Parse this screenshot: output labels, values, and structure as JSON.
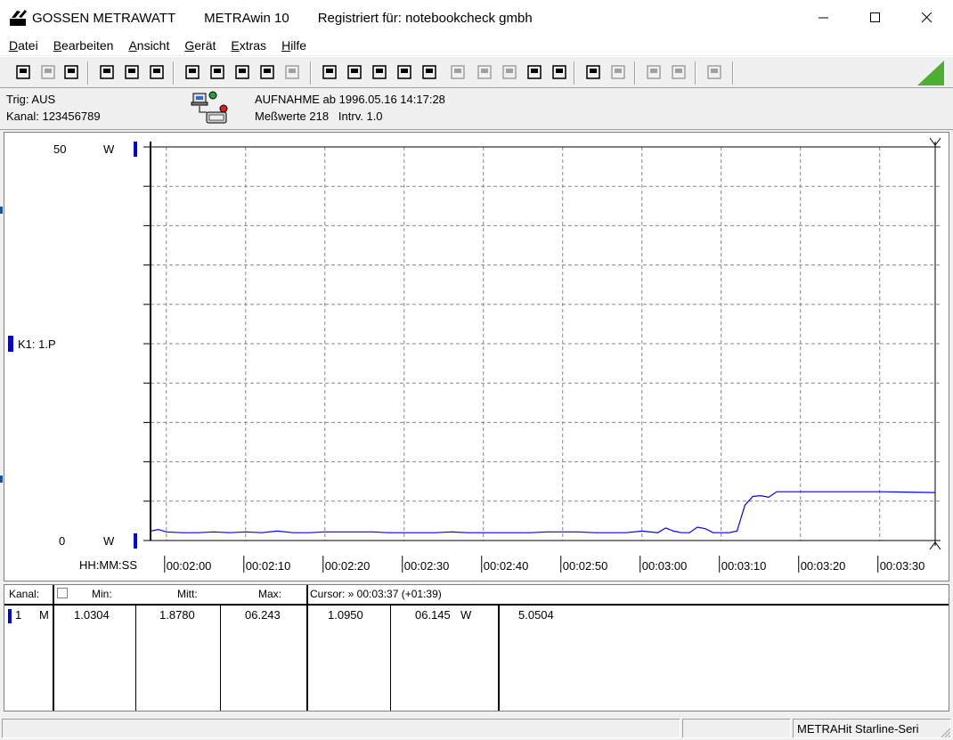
{
  "window": {
    "brand": "GOSSEN METRAWATT",
    "app_name": "METRAwin 10",
    "registration": "Registriert für: notebookcheck gmbh"
  },
  "menu": {
    "items": [
      {
        "ul": "D",
        "rest": "atei"
      },
      {
        "ul": "B",
        "rest": "earbeiten"
      },
      {
        "ul": "A",
        "rest": "nsicht"
      },
      {
        "ul": "G",
        "rest": "erät"
      },
      {
        "ul": "E",
        "rest": "xtras"
      },
      {
        "ul": "H",
        "rest": "ilfe"
      }
    ]
  },
  "toolbar": {
    "icons": [
      "save-icon",
      "save-disabled-icon",
      "open-folder-icon",
      "device-connect-icon",
      "device-settings-icon",
      "device-export-icon",
      "keyboard-icon",
      "waveform-icon",
      "crosshair-icon",
      "table-icon",
      "grid-disabled-icon",
      "print-preview-icon",
      "window-icon",
      "list-icon",
      "monitor-icon",
      "function-icon",
      "calculator-disabled-icon",
      "signal-disabled-icon",
      "signal-disabled-2-icon",
      "settings-gear-icon",
      "clock-settings-icon",
      "printer-icon",
      "printer-disabled-icon",
      "zoom-disabled-icon",
      "zoom-disabled-2-icon",
      "message-disabled-icon"
    ]
  },
  "info": {
    "trigger": "Trig: AUS",
    "channel": "Kanal: 123456789",
    "recording": "AUFNAHME ab 1996.05.16 14:17:28",
    "samples": "Meßwerte 218   Intrv. 1.0"
  },
  "chart_data": {
    "type": "line",
    "y_top_label": "50",
    "y_bottom_label": "0",
    "y_unit": "W",
    "channel_label": "K1: 1.P",
    "xlabel": "HH:MM:SS",
    "x_ticks": [
      "00:02:00",
      "00:02:10",
      "00:02:20",
      "00:02:30",
      "00:02:40",
      "00:02:50",
      "00:03:00",
      "00:03:10",
      "00:03:20",
      "00:03:30"
    ],
    "ylim": [
      0,
      50
    ],
    "xlim_seconds": [
      118,
      217
    ],
    "grid": true,
    "series": [
      {
        "color": "#0000ff",
        "x": [
          118,
          119,
          120,
          122,
          124,
          126,
          128,
          130,
          132,
          134,
          136,
          138,
          140,
          142,
          144,
          146,
          148,
          150,
          152,
          154,
          156,
          158,
          160,
          162,
          164,
          166,
          168,
          170,
          172,
          174,
          176,
          178,
          180,
          182,
          183,
          184,
          185,
          186,
          187,
          188,
          189,
          190,
          191,
          192,
          193,
          194,
          195,
          196,
          197,
          198,
          200,
          204,
          210,
          217
        ],
        "y": [
          1.2,
          1.4,
          1.1,
          1.0,
          1.0,
          1.1,
          1.0,
          1.1,
          1.0,
          1.2,
          1.0,
          1.0,
          1.1,
          1.1,
          1.1,
          1.1,
          1.0,
          1.0,
          1.0,
          1.0,
          1.1,
          1.0,
          1.0,
          1.0,
          1.0,
          1.0,
          1.1,
          1.1,
          1.1,
          1.0,
          1.0,
          1.0,
          1.2,
          1.0,
          1.6,
          1.2,
          1.0,
          1.0,
          1.7,
          1.5,
          1.0,
          1.0,
          1.0,
          1.2,
          4.5,
          5.6,
          5.7,
          5.5,
          6.2,
          6.2,
          6.2,
          6.2,
          6.2,
          6.1
        ]
      }
    ]
  },
  "table": {
    "headers": {
      "kanal": "Kanal:",
      "min": "Min:",
      "mitt": "Mitt:",
      "max": "Max:",
      "cursor": "Cursor: » 00:03:37 (+01:39)"
    },
    "row": {
      "channel_number": "1",
      "mode": "M",
      "min": "1.0304",
      "mitt": "1.8780",
      "max": "06.243",
      "cursor_value": "1.0950",
      "cursor_value2": "06.145",
      "unit": "W",
      "diff": "5.0504"
    }
  },
  "status": {
    "device": "METRAHit Starline-Seri"
  }
}
